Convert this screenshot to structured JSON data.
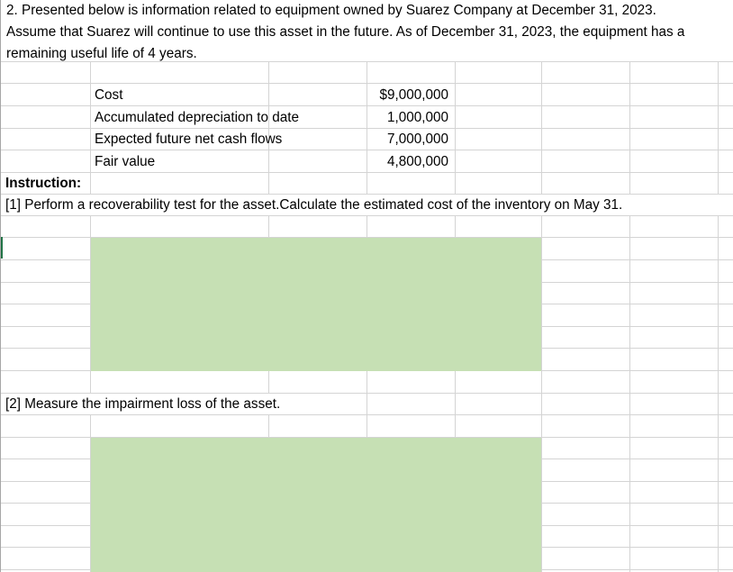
{
  "problem": {
    "description_lines": [
      "2. Presented below is information related to equipment owned by Suarez Company at December 31, 2023.",
      "Assume that Suarez will continue to use this asset in the future. As of December 31, 2023, the equipment has a",
      "remaining useful life of 4 years."
    ],
    "items": [
      {
        "label": "Cost",
        "value": "$9,000,000"
      },
      {
        "label": "Accumulated depreciation to date",
        "value": "1,000,000"
      },
      {
        "label": "Expected future net cash flows",
        "value": "7,000,000"
      },
      {
        "label": "Fair value",
        "value": "4,800,000"
      }
    ],
    "instruction_heading": "Instruction:",
    "task1": "[1] Perform a recoverability test for the asset.Calculate the estimated cost of the inventory on May 31.",
    "task2": "[2] Measure the impairment loss of the asset."
  },
  "colors": {
    "answer_fill": "#c6e0b4",
    "gridline": "#d4d4d4"
  }
}
